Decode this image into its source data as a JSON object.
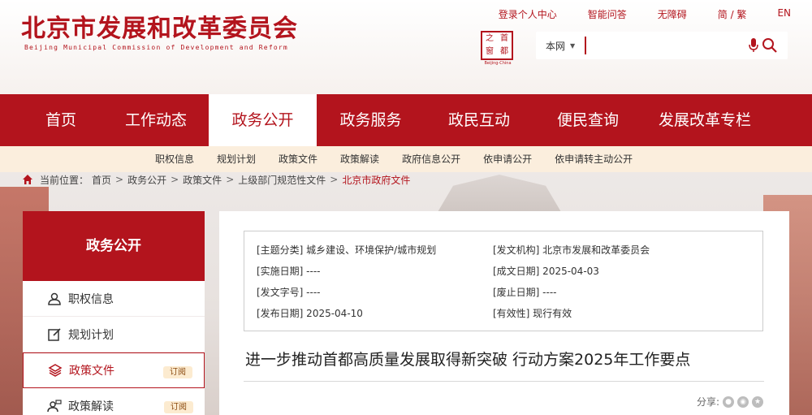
{
  "site": {
    "title_cn": "北京市发展和改革委员会",
    "title_en": "Beijing Municipal Commission of Development and Reform"
  },
  "toplinks": [
    "登录个人中心",
    "智能问答",
    "无障碍",
    "简 / 繁",
    "EN"
  ],
  "emblem": {
    "chars": [
      "之",
      "首",
      "窗",
      "都"
    ],
    "sub": "Beijing-China"
  },
  "search": {
    "scope": "本网",
    "placeholder": ""
  },
  "mainnav": {
    "items": [
      "首页",
      "工作动态",
      "政务公开",
      "政务服务",
      "政民互动",
      "便民查询",
      "发展改革专栏"
    ],
    "active": "政务公开"
  },
  "subnav": [
    "职权信息",
    "规划计划",
    "政策文件",
    "政策解读",
    "政府信息公开",
    "依申请公开",
    "依申请转主动公开"
  ],
  "breadcrumb": {
    "label": "当前位置：",
    "items": [
      "首页",
      "政务公开",
      "政策文件",
      "上级部门规范性文件"
    ],
    "current": "北京市政府文件"
  },
  "sidebar": {
    "heading": "政务公开",
    "items": [
      {
        "label": "职权信息",
        "badge": ""
      },
      {
        "label": "规划计划",
        "badge": ""
      },
      {
        "label": "政策文件",
        "badge": "订阅"
      },
      {
        "label": "政策解读",
        "badge": "订阅"
      }
    ]
  },
  "meta": {
    "subject": "[主题分类] 城乡建设、环境保护/城市规划",
    "issuer": "[发文机构] 北京市发展和改革委员会",
    "effective_date": "[实施日期] ----",
    "created_date": "[成文日期] 2025-04-03",
    "doc_number": "[发文字号] ----",
    "repeal_date": "[废止日期] ----",
    "publish_date": "[发布日期] 2025-04-10",
    "validity": "[有效性] 现行有效"
  },
  "document": {
    "title": "进一步推动首都高质量发展取得新突破 行动方案2025年工作要点"
  },
  "share": {
    "label": "分享:"
  },
  "colors": {
    "brand_red": "#b3141d",
    "subnav_bg": "#fbeedd"
  }
}
